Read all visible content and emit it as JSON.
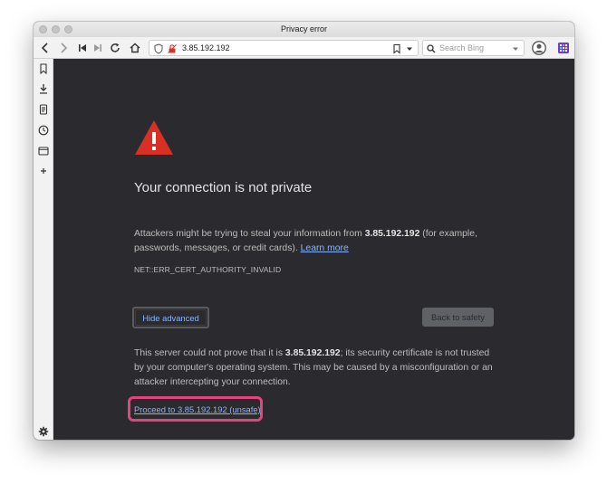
{
  "window": {
    "title": "Privacy error"
  },
  "toolbar": {
    "url": "3.85.192.192",
    "search_placeholder": "Search Bing"
  },
  "page": {
    "heading": "Your connection is not private",
    "intro_before": "Attackers might be trying to steal your information from ",
    "intro_host": "3.85.192.192",
    "intro_after": " (for example, passwords, messages, or credit cards). ",
    "learn_more": "Learn more",
    "error_code": "NET::ERR_CERT_AUTHORITY_INVALID",
    "hide_advanced": "Hide advanced",
    "back_to_safety": "Back to safety",
    "details_before": "This server could not prove that it is ",
    "details_host": "3.85.192.192",
    "details_after": "; its security certificate is not trusted by your computer's operating system. This may be caused by a misconfiguration or an attacker intercepting your connection.",
    "proceed_link": "Proceed to 3.85.192.192 (unsafe)"
  },
  "colors": {
    "page_bg": "#2b2b2f",
    "warning_red": "#d93025",
    "link_blue": "#8ab4f8",
    "highlight_pink": "#e6427f"
  }
}
